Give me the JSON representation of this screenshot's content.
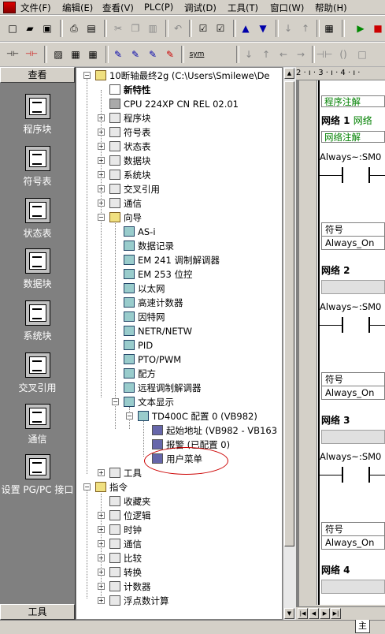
{
  "menu": [
    "文件(F)",
    "编辑(E)",
    "查看(V)",
    "PLC(P)",
    "调试(D)",
    "工具(T)",
    "窗口(W)",
    "帮助(H)"
  ],
  "toolbar2": {
    "sym_label": "sym"
  },
  "sidebar": {
    "header": "查看",
    "footer": "工具",
    "items": [
      "程序块",
      "符号表",
      "状态表",
      "数据块",
      "系统块",
      "交叉引用",
      "通信",
      "设置 PG/PC 接口"
    ]
  },
  "tree": {
    "project": "10断轴最终2g (C:\\Users\\Smilewe\\De",
    "new_feature": "新特性",
    "cpu": "CPU 224XP CN REL 02.01",
    "nodes": [
      "程序块",
      "符号表",
      "状态表",
      "数据块",
      "系统块",
      "交叉引用",
      "通信",
      "向导"
    ],
    "wizards": [
      "AS-i",
      "数据记录",
      "EM 241 调制解调器",
      "EM 253 位控",
      "以太网",
      "高速计数器",
      "因特网",
      "NETR/NETW",
      "PID",
      "PTO/PWM",
      "配方",
      "远程调制解调器",
      "文本显示"
    ],
    "td400": "TD400C 配置 0 (VB982)",
    "td400_children": [
      "起始地址 (VB982 - VB163",
      "报警 (已配置 0)",
      "用户菜单"
    ],
    "tools": "工具",
    "instructions": "指令",
    "instruction_items": [
      "收藏夹",
      "位逻辑",
      "时钟",
      "通信",
      "比较",
      "转换",
      "计数器",
      "浮点数计算"
    ]
  },
  "ruler": "2 · ı · 3 · ı · 4 · ı ·",
  "editor": {
    "program_comment": "程序注解",
    "network_comment": "网络注解",
    "networks": [
      {
        "label": "网络 1",
        "comment": "网络"
      },
      {
        "label": "网络 2"
      },
      {
        "label": "网络 3"
      },
      {
        "label": "网络 4"
      }
    ],
    "contact": "Always~:SM0",
    "sym_header": "符号",
    "sym_value": "Always_On"
  },
  "tabs": {
    "main": "主"
  }
}
